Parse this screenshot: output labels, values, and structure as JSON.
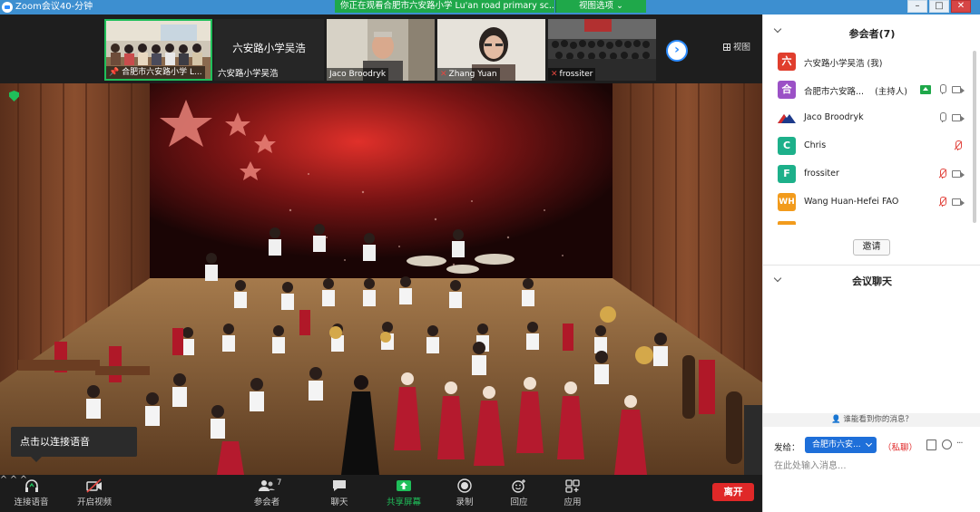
{
  "window": {
    "title": "Zoom会议40-分钟",
    "share_banner": "你正在观看合肥市六安路小学 Lu'an road primary sc...的屏幕",
    "view_options": "视图选项 ⌄"
  },
  "thumbnails": [
    {
      "name": "合肥市六安路小学 L..."
    },
    {
      "name": "Jaco Broodryk"
    },
    {
      "name": "Zhang Yuan"
    },
    {
      "name": "frossiter"
    }
  ],
  "name_tile": {
    "big": "六安路小学吴浩",
    "small": "六安路小学吴浩"
  },
  "view_button": "视图",
  "audio_tip": "点击以连接语音",
  "toolbar": {
    "connect_audio": "连接语音",
    "start_video": "开启视频",
    "participants": "参会者",
    "participants_count": "7",
    "chat": "聊天",
    "share_screen": "共享屏幕",
    "record": "录制",
    "reactions": "回应",
    "apps": "应用",
    "leave": "离开"
  },
  "panel": {
    "participants_title": "参会者(7)",
    "participants": [
      {
        "initial": "六",
        "color": "#e03e2d",
        "name": "六安路小学吴浩 (我)"
      },
      {
        "initial": "合",
        "color": "#9b51c6",
        "name": "合肥市六安路...",
        "role": "(主持人)"
      },
      {
        "initial": "",
        "color": "#1d3a8a",
        "name": "Jaco Broodryk"
      },
      {
        "initial": "C",
        "color": "#1db08a",
        "name": "Chris"
      },
      {
        "initial": "F",
        "color": "#1db08a",
        "name": "frossiter"
      },
      {
        "initial": "WH",
        "color": "#f29b1c",
        "name": "Wang Huan-Hefei FAO"
      }
    ],
    "invite": "邀请",
    "chat_title": "会议聊天",
    "who_sees": "谁能看到你的消息？",
    "send_to": "发给：",
    "recipient": "合肥市六安...",
    "private": "（私聊）",
    "input_placeholder": "在此处输入消息..."
  }
}
